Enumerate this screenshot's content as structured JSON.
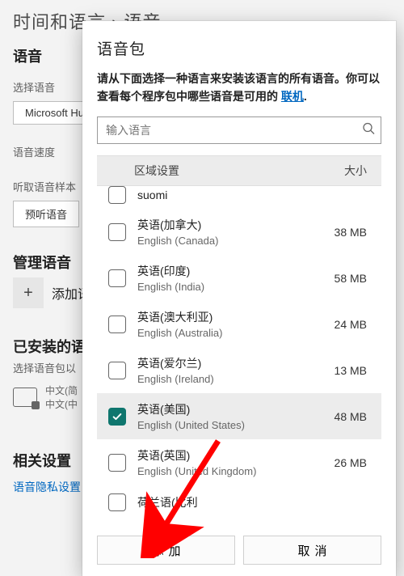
{
  "breadcrumb": "时间和语言  ›  语音",
  "bg": {
    "title_voice": "语音",
    "select_voice_label": "选择语音",
    "selected_voice": "Microsoft Hu",
    "speed_label": "语音速度",
    "sample_label": "听取语音样本",
    "preview_btn": "预听语音",
    "manage_title": "管理语音",
    "add_voice": "添加语",
    "installed_title": "已安装的语",
    "installed_hint": "选择语音包以",
    "cn_line1": "中文(简",
    "cn_line2": "中文(中",
    "related_title": "相关设置",
    "privacy_link": "语音隐私设置"
  },
  "modal": {
    "title": "语音包",
    "desc_a": "请从下面选择一种语言来安装该语言的所有语音。你可以查看每个程序包中哪些语音是可用的 ",
    "desc_link": "联机",
    "desc_b": ".",
    "search_placeholder": "输入语言",
    "col_region": "区域设置",
    "col_size": "大小",
    "rows": [
      {
        "name": "suomi",
        "sub": "",
        "size": "",
        "partial": "top",
        "selected": false,
        "checked": false
      },
      {
        "name": "英语(加拿大)",
        "sub": "English (Canada)",
        "size": "38 MB",
        "selected": false,
        "checked": false
      },
      {
        "name": "英语(印度)",
        "sub": "English (India)",
        "size": "58 MB",
        "selected": false,
        "checked": false
      },
      {
        "name": "英语(澳大利亚)",
        "sub": "English (Australia)",
        "size": "24 MB",
        "selected": false,
        "checked": false
      },
      {
        "name": "英语(爱尔兰)",
        "sub": "English (Ireland)",
        "size": "13 MB",
        "selected": false,
        "checked": false
      },
      {
        "name": "英语(美国)",
        "sub": "English (United States)",
        "size": "48 MB",
        "selected": true,
        "checked": true
      },
      {
        "name": "英语(英国)",
        "sub": "English (United Kingdom)",
        "size": "26 MB",
        "selected": false,
        "checked": false
      },
      {
        "name": "荷兰语(比利",
        "sub": "",
        "size": "",
        "partial": "bot",
        "selected": false,
        "checked": false
      }
    ],
    "btn_add": "添加",
    "btn_cancel": "取消"
  }
}
